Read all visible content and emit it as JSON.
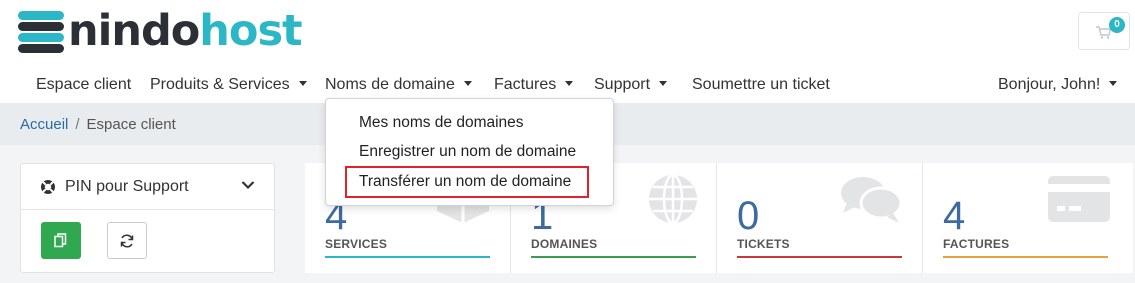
{
  "brand": {
    "name_part1": "nindo",
    "name_part2": "host",
    "colors": {
      "dark": "#2b2f36",
      "accent": "#2bb7c6"
    }
  },
  "cart": {
    "count": "0",
    "icon": "cart-icon"
  },
  "nav": {
    "items": [
      {
        "label": "Espace client",
        "has_caret": false
      },
      {
        "label": "Produits & Services",
        "has_caret": true
      },
      {
        "label": "Noms de domaine",
        "has_caret": true
      },
      {
        "label": "Factures",
        "has_caret": true
      },
      {
        "label": "Support",
        "has_caret": true
      },
      {
        "label": "Soumettre un ticket",
        "has_caret": false
      }
    ],
    "user": {
      "label": "Bonjour, John!",
      "has_caret": true
    }
  },
  "breadcrumb": {
    "home": "Accueil",
    "separator": "/",
    "current": "Espace client"
  },
  "dropdown": {
    "items": [
      {
        "label": "Mes noms de domaines"
      },
      {
        "label": "Enregistrer un nom de domaine"
      },
      {
        "label": "Transférer un nom de domaine",
        "highlighted": true
      }
    ],
    "highlight_color": "#e0232a"
  },
  "pin_card": {
    "title": "PIN pour Support",
    "icon": "lifebuoy-icon"
  },
  "stats": [
    {
      "value": "4",
      "label": "SERVICES",
      "color": "#2bb7c6",
      "icon": "cube-icon"
    },
    {
      "value": "1",
      "label": "DOMAINES",
      "color": "#3a9d4f",
      "icon": "globe-icon"
    },
    {
      "value": "0",
      "label": "TICKETS",
      "color": "#c8373b",
      "icon": "comments-icon"
    },
    {
      "value": "4",
      "label": "FACTURES",
      "color": "#e9a23b",
      "icon": "credit-card-icon"
    }
  ]
}
